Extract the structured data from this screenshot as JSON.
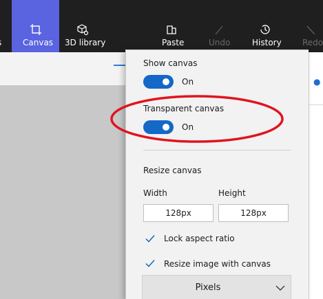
{
  "toolbar": {
    "cut_label": "s",
    "canvas_label": "Canvas",
    "library_label": "3D library",
    "paste_label": "Paste",
    "undo_label": "Undo",
    "history_label": "History",
    "redo_label": "Redo"
  },
  "panel": {
    "show_canvas": {
      "label": "Show canvas",
      "state": "On",
      "on": true
    },
    "transparent_canvas": {
      "label": "Transparent canvas",
      "state": "On",
      "on": true
    },
    "resize": {
      "title": "Resize canvas",
      "width_label": "Width",
      "height_label": "Height",
      "width_value": "128px",
      "height_value": "128px",
      "lock_aspect_label": "Lock aspect ratio",
      "lock_aspect_checked": true,
      "resize_image_label": "Resize image with canvas",
      "resize_image_checked": true,
      "units_value": "Pixels"
    }
  },
  "colors": {
    "toolbar_bg": "#1f1f1f",
    "canvas_tab_active": "#5a63e0",
    "toggle_on": "#1468c8",
    "annotation": "#e0141e"
  },
  "icons": {
    "canvas": "canvas-crop-icon",
    "library": "3d-library-icon",
    "paste": "paste-icon",
    "undo": "undo-icon",
    "history": "history-icon",
    "redo": "redo-icon",
    "checkmark": "checkmark-icon",
    "chevron": "chevron-down-icon"
  }
}
